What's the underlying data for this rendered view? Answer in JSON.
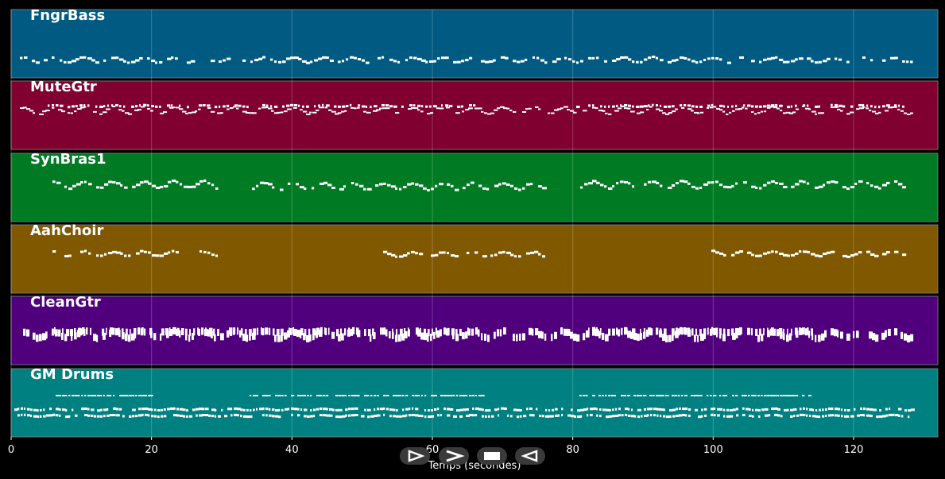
{
  "xaxis": {
    "label": "Temps (secondes)",
    "ticks": [
      0,
      20,
      40,
      60,
      80,
      100,
      120
    ],
    "range": [
      0,
      132
    ]
  },
  "tracks": [
    {
      "name": "FngrBass",
      "color": "#005a82",
      "density": "bass"
    },
    {
      "name": "MuteGtr",
      "color": "#800030",
      "density": "rhythm"
    },
    {
      "name": "SynBras1",
      "color": "#007b23",
      "density": "melody"
    },
    {
      "name": "AahChoir",
      "color": "#7f5800",
      "density": "choir"
    },
    {
      "name": "CleanGtr",
      "color": "#50007d",
      "density": "chords"
    },
    {
      "name": "GM Drums",
      "color": "#008080",
      "density": "drums"
    }
  ],
  "controls": [
    {
      "name": "play-forward-button",
      "icon": "play-outline-icon"
    },
    {
      "name": "fast-forward-button",
      "icon": "chevron-right-icon"
    },
    {
      "name": "stop-button",
      "icon": "stop-icon"
    },
    {
      "name": "rewind-button",
      "icon": "play-backward-icon"
    }
  ]
}
